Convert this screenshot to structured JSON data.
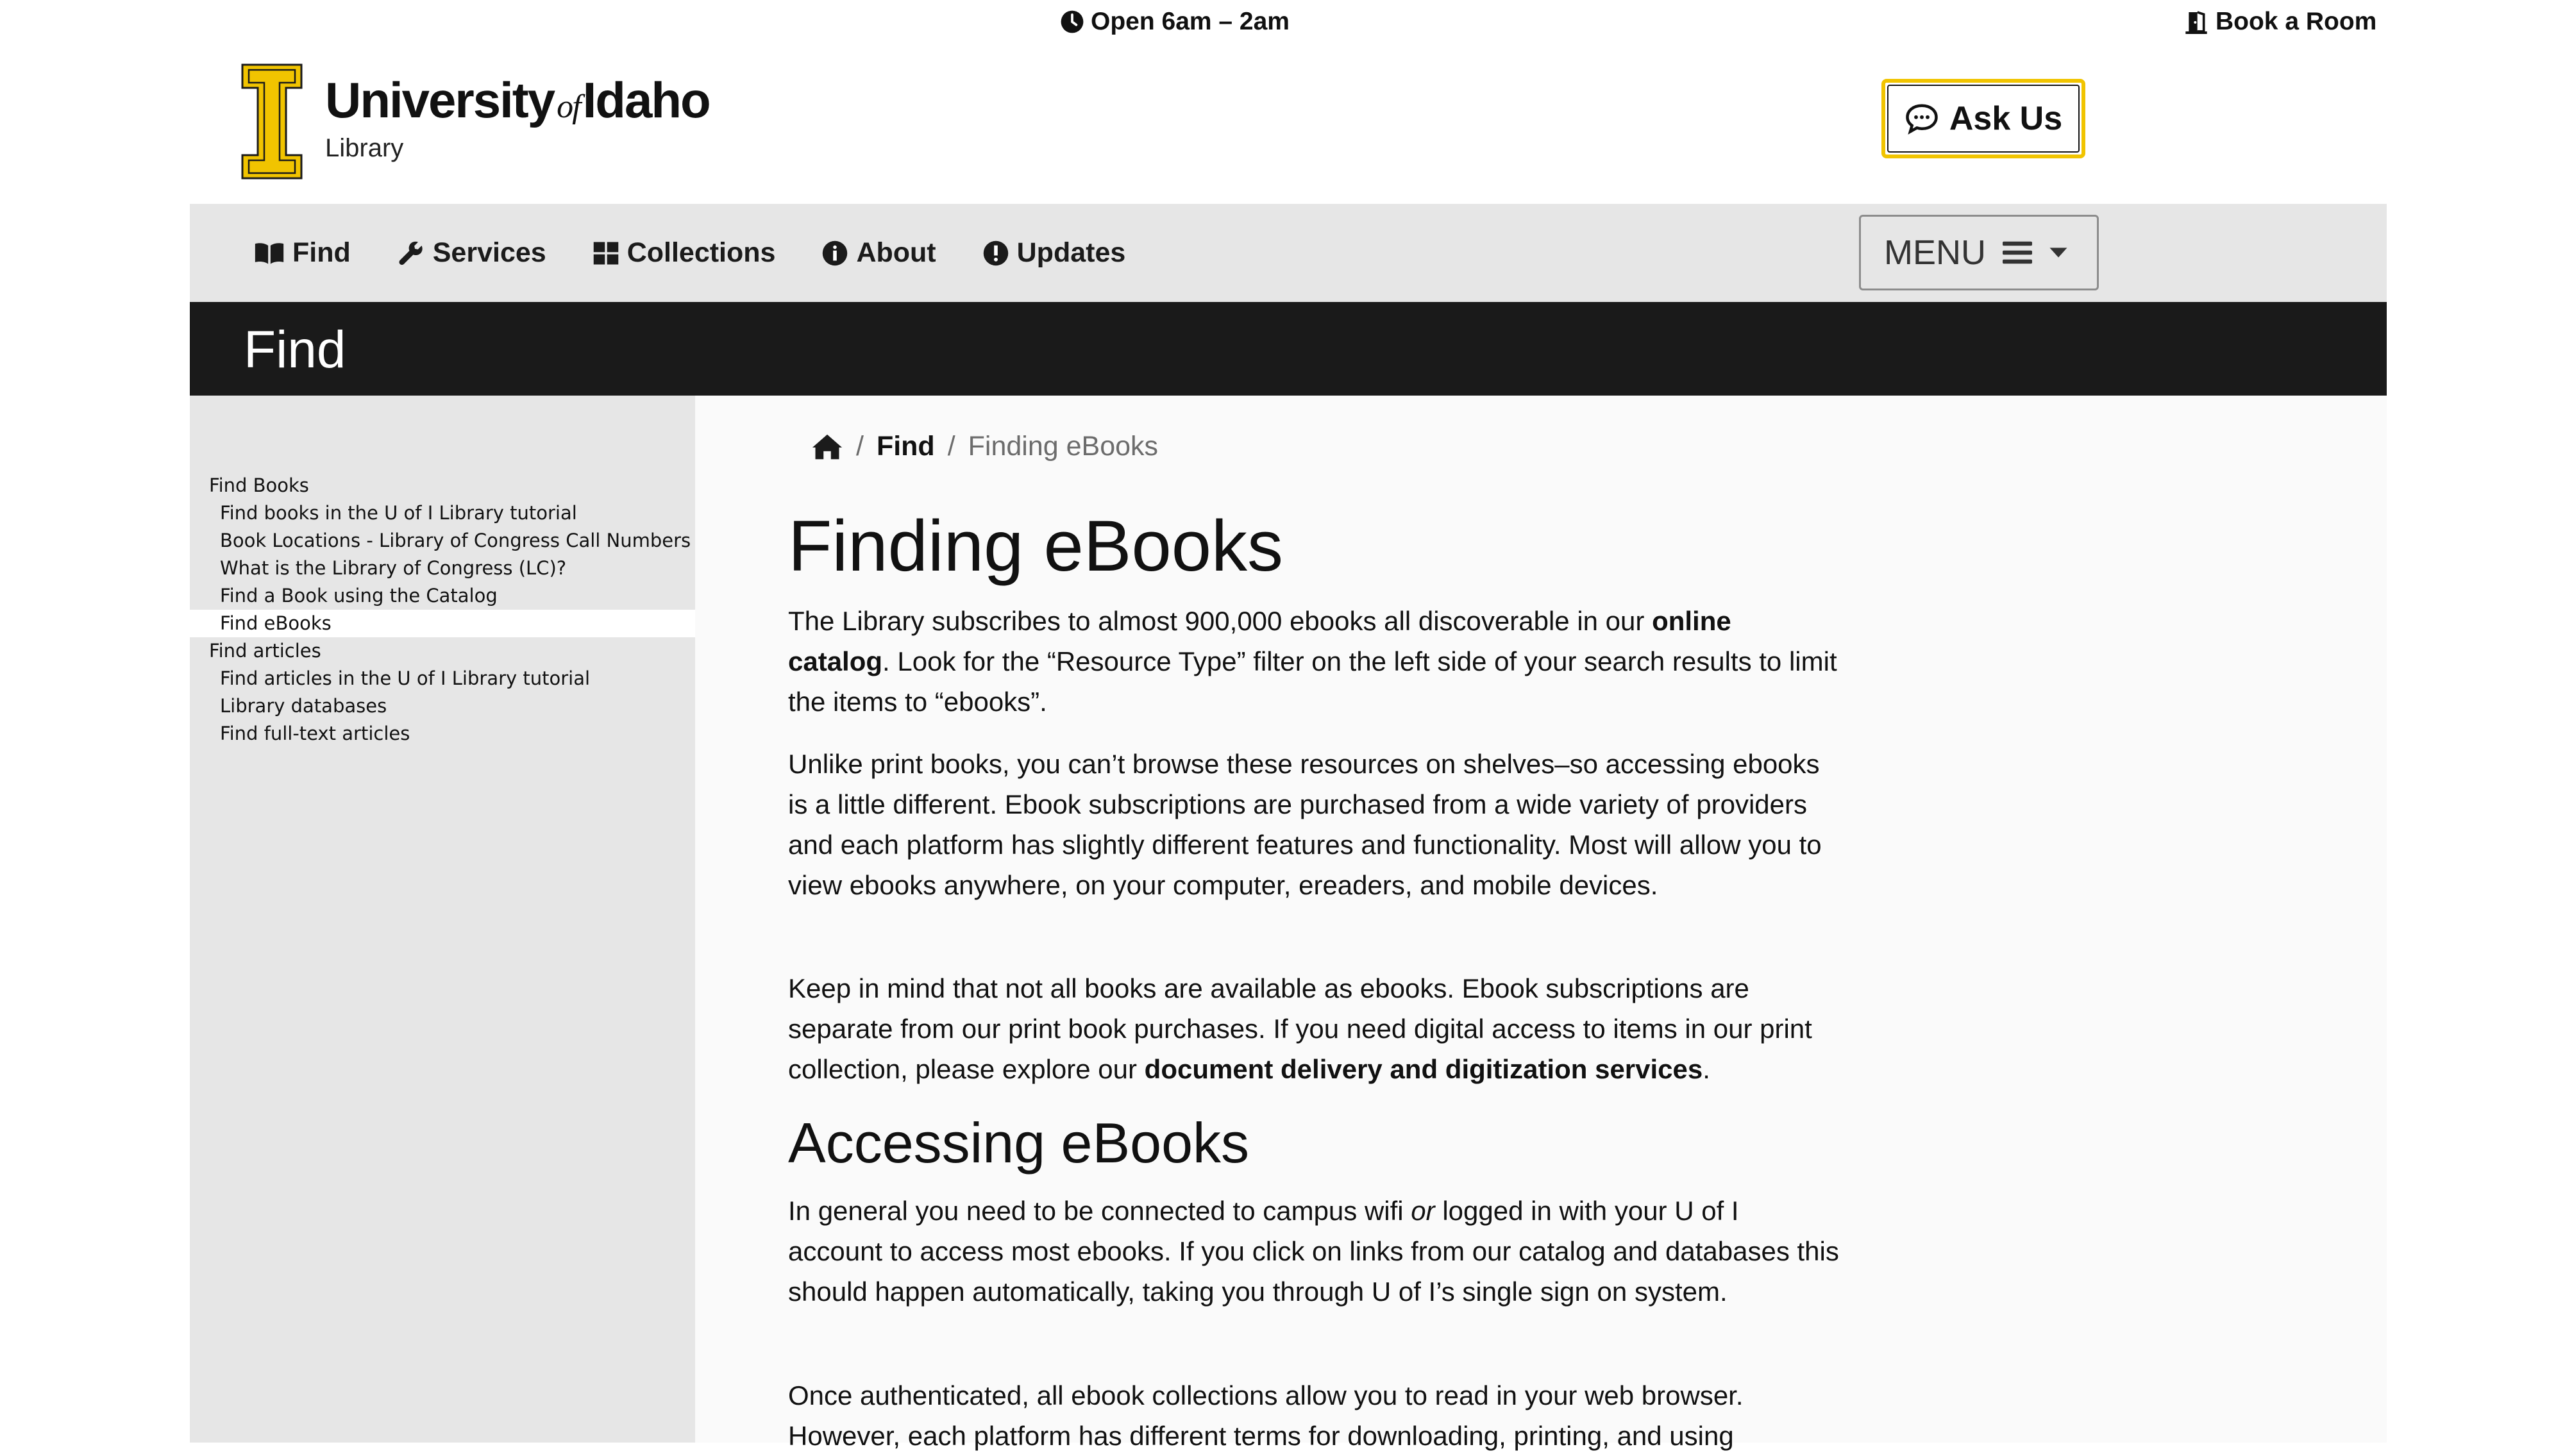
{
  "utility": {
    "hours": "Open 6am – 2am",
    "book_room": "Book a Room"
  },
  "header": {
    "logo_word_1": "University",
    "logo_word_of": "of",
    "logo_word_2": "Idaho",
    "logo_sub": "Library",
    "ask_us": "Ask Us",
    "brand_color": "#f1c400"
  },
  "nav": {
    "items": [
      {
        "label": "Find",
        "icon": "book-open-icon"
      },
      {
        "label": "Services",
        "icon": "wrench-icon"
      },
      {
        "label": "Collections",
        "icon": "grid-icon"
      },
      {
        "label": "About",
        "icon": "info-circle-icon"
      },
      {
        "label": "Updates",
        "icon": "exclamation-circle-icon"
      }
    ],
    "menu_label": "MENU"
  },
  "banner": {
    "title": "Find"
  },
  "sidebar": {
    "items": [
      {
        "label": "Find Books",
        "level": 1
      },
      {
        "label": "Find books in the U of I Library tutorial",
        "level": 2
      },
      {
        "label": "Book Locations - Library of Congress Call Numbers",
        "level": 2
      },
      {
        "label": "What is the Library of Congress (LC)?",
        "level": 2
      },
      {
        "label": "Find a Book using the Catalog",
        "level": 2
      },
      {
        "label": "Find eBooks",
        "level": 2,
        "active": true
      },
      {
        "label": "Find articles",
        "level": 1
      },
      {
        "label": "Find articles in the U of I Library tutorial",
        "level": 2
      },
      {
        "label": "Library databases",
        "level": 2
      },
      {
        "label": "Find full-text articles",
        "level": 2
      }
    ]
  },
  "breadcrumb": {
    "sep": "/",
    "parent": "Find",
    "current": "Finding eBooks"
  },
  "content": {
    "title": "Finding eBooks",
    "p1": {
      "a": "The Library subscribes to almost 900,000 ebooks all discoverable in our ",
      "link": "online catalog",
      "b": ". Look for the “Resource Type” filter on the left side of your search results to limit the items to “ebooks”."
    },
    "p2": "Unlike print books, you can’t browse these resources on shelves–so accessing ebooks is a little different. Ebook subscriptions are purchased from a wide variety of providers and each platform has slightly different features and functionality. Most will allow you to view ebooks anywhere, on your computer, ereaders, and mobile devices.",
    "p3": {
      "a": "Keep in mind that not all books are available as ebooks. Ebook subscriptions are separate from our print book purchases. If you need digital access to items in our print collection, please explore our ",
      "link": "document delivery and digitization services",
      "b": "."
    },
    "section2_title": "Accessing eBooks",
    "p4": {
      "a": "In general you need to be connected to campus wifi ",
      "em": "or",
      "b": " logged in with your U of I account to access most ebooks. If you click on links from our catalog and databases this should happen automatically, taking you through U of I’s single sign on system."
    },
    "p5": "Once authenticated, all ebook collections allow you to read in your web browser. However, each platform has different terms for downloading, printing, and using"
  }
}
